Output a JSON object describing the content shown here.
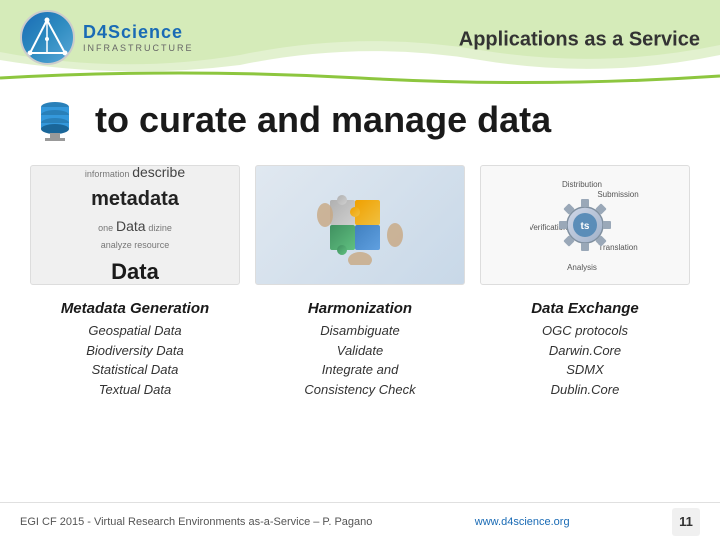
{
  "header": {
    "logo": {
      "name": "D4Science",
      "subtext": "INFRASTRUCTURE"
    },
    "title": "Applications as a Service"
  },
  "subtitle": {
    "text": "to curate and manage data"
  },
  "columns": [
    {
      "title": "Metadata Generation",
      "items": [
        "Geospatial Data",
        "Biodiversity Data",
        "Statistical Data",
        "Textual Data"
      ]
    },
    {
      "title": "Harmonization",
      "items": [
        "Disambiguate",
        "Validate",
        "Integrate and",
        "Consistency Check"
      ]
    },
    {
      "title": "Data Exchange",
      "items": [
        "OGC protocols",
        "Darwin.Core",
        "SDMX",
        "Dublin.Core"
      ]
    }
  ],
  "footer": {
    "text": "EGI CF 2015 - Virtual Research Environments as-a-Service – P. Pagano",
    "url": "www.d4science.org",
    "page_number": "11"
  }
}
